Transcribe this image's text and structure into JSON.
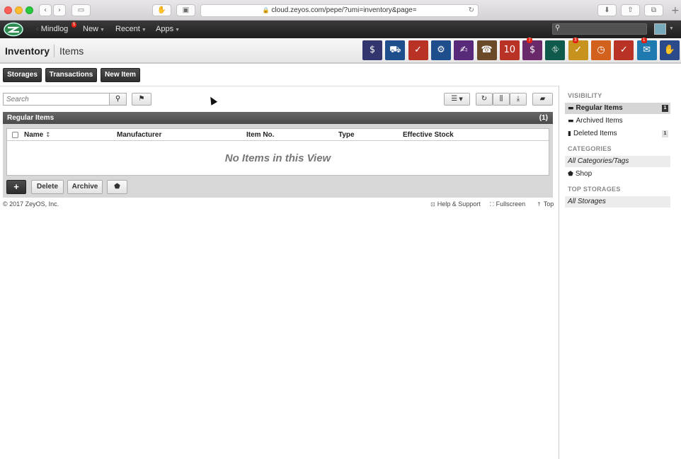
{
  "browser": {
    "url": "cloud.zeyos.com/pepe/?umi=inventory&page=",
    "back_icon": "chevron-left",
    "forward_icon": "chevron-right",
    "sidebar_icon": "sidebar",
    "download_icon": "download",
    "share_icon": "share",
    "tabs_icon": "tabs"
  },
  "nav": {
    "mindlog_label": "Mindlog",
    "mindlog_badge": "5",
    "new_label": "New",
    "recent_label": "Recent",
    "apps_label": "Apps",
    "search_placeholder": ""
  },
  "header": {
    "title": "Inventory",
    "subtitle": "Items"
  },
  "app_icons": [
    {
      "name": "finance-icon",
      "color": "#33356e",
      "glyph": "$"
    },
    {
      "name": "shipping-icon",
      "color": "#1f4e8c",
      "glyph": "⛟"
    },
    {
      "name": "tasks-icon",
      "color": "#b83226",
      "glyph": "✓"
    },
    {
      "name": "settings-icon",
      "color": "#1f4e8c",
      "glyph": "⚙"
    },
    {
      "name": "documents-icon",
      "color": "#5a2a7a",
      "glyph": "✍"
    },
    {
      "name": "contacts-icon",
      "color": "#6b4a2a",
      "glyph": "☎"
    },
    {
      "name": "calendar-icon",
      "color": "#b83226",
      "glyph": "10"
    },
    {
      "name": "sales-icon",
      "color": "#6a2a6a",
      "glyph": "$",
      "badge": "7"
    },
    {
      "name": "inventory-icon",
      "color": "#0f5a4a",
      "glyph": "⛗"
    },
    {
      "name": "checklist-icon",
      "color": "#c8921e",
      "glyph": "✓",
      "badge": "3"
    },
    {
      "name": "timer-icon",
      "color": "#d2611e",
      "glyph": "◷"
    },
    {
      "name": "invoice-icon",
      "color": "#b83226",
      "glyph": "✓"
    },
    {
      "name": "mail-icon",
      "color": "#1f7ab0",
      "glyph": "✉",
      "badge": "1"
    },
    {
      "name": "deals-icon",
      "color": "#2a4a8a",
      "glyph": "✋"
    }
  ],
  "actions": {
    "storages": "Storages",
    "transactions": "Transactions",
    "new_item": "New Item"
  },
  "search": {
    "placeholder": "Search"
  },
  "panel": {
    "title": "Regular Items",
    "count": "(1)",
    "columns": [
      "Name",
      "Manufacturer",
      "Item No.",
      "Type",
      "Effective Stock"
    ],
    "empty_message": "No Items in this View"
  },
  "bottom_actions": {
    "add": "+",
    "delete": "Delete",
    "archive": "Archive"
  },
  "footer": {
    "copyright": "© 2017 ZeyOS, Inc.",
    "help": "Help & Support",
    "fullscreen": "Fullscreen",
    "top": "Top"
  },
  "sidebar": {
    "visibility_title": "VISIBILITY",
    "visibility_items": [
      {
        "label": "Regular Items",
        "badge": "1"
      },
      {
        "label": "Archived Items",
        "badge": ""
      },
      {
        "label": "Deleted Items",
        "badge": "1"
      }
    ],
    "categories_title": "CATEGORIES",
    "categories_items": [
      "All Categories/Tags",
      "Shop"
    ],
    "storages_title": "TOP STORAGES",
    "storages_items": [
      "All Storages"
    ]
  }
}
